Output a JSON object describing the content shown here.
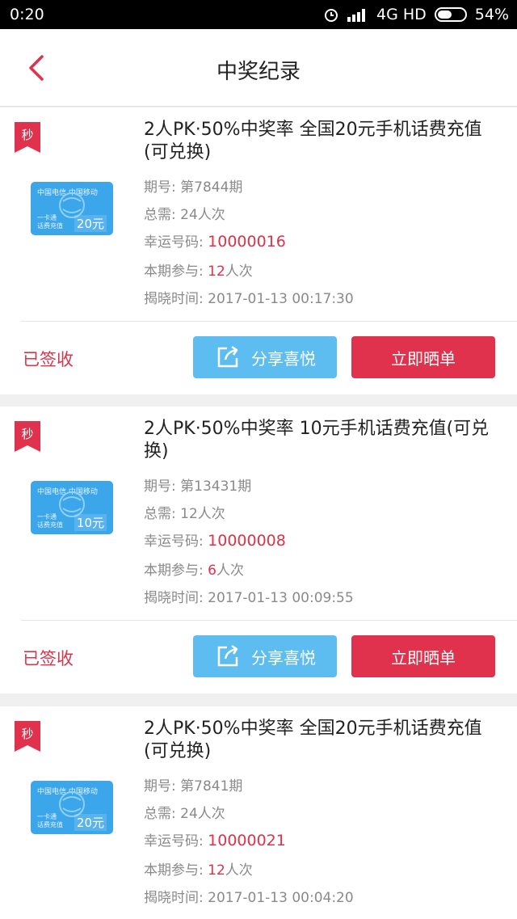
{
  "status": {
    "time": "0:20",
    "network": "4G HD",
    "battery": "54%",
    "battery_level": 0.54
  },
  "header": {
    "title": "中奖纪录"
  },
  "labels": {
    "issue": "期号: ",
    "total": "总需: ",
    "lucky": "幸运号码: ",
    "joined": "本期参与: ",
    "reveal": "揭晓时间: ",
    "ribbon": "秒",
    "signed": "已签收",
    "share": "分享喜悦",
    "show": "立即晒单",
    "people_unit": "人次"
  },
  "colors": {
    "accent": "#e0324c",
    "share": "#5dbcf0",
    "text_red": "#d8344a"
  },
  "records": [
    {
      "title": "2人PK·50%中奖率 全国20元手机话费充值(可兑换)",
      "issue": "第7844期",
      "total": "24人次",
      "lucky": "10000016",
      "joined": "12",
      "reveal_time": "2017-01-13 00:17:30",
      "card_amount": "20元"
    },
    {
      "title": "2人PK·50%中奖率 10元手机话费充值(可兑换)",
      "issue": "第13431期",
      "total": "12人次",
      "lucky": "10000008",
      "joined": "6",
      "reveal_time": "2017-01-13 00:09:55",
      "card_amount": "10元"
    },
    {
      "title": "2人PK·50%中奖率 全国20元手机话费充值(可兑换)",
      "issue": "第7841期",
      "total": "24人次",
      "lucky": "10000021",
      "joined": "12",
      "reveal_time": "2017-01-13 00:04:20",
      "card_amount": "20元"
    }
  ]
}
